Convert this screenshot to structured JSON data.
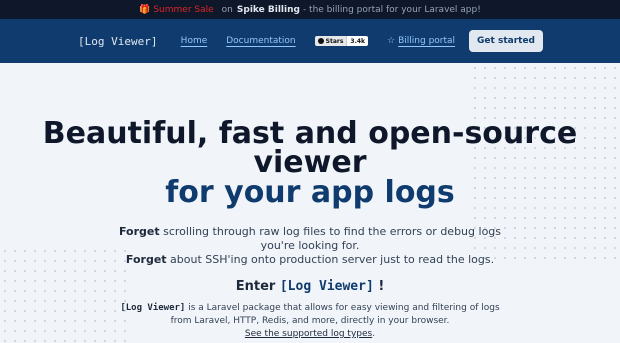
{
  "announcement": {
    "icon": "gift-icon",
    "sale": "Summer Sale",
    "on": "on",
    "product": "Spike Billing",
    "rest": "- the billing portal for your Laravel app!"
  },
  "header": {
    "logo": "[Log Viewer]",
    "nav": {
      "home": "Home",
      "documentation": "Documentation",
      "billing": "Billing portal"
    },
    "github": {
      "label": "Stars",
      "count": "3.4k"
    },
    "cta": "Get started"
  },
  "hero": {
    "line1": "Beautiful, fast and open-source",
    "line2": "viewer",
    "line3": "for your app logs",
    "lead1_bold": "Forget",
    "lead1": "scrolling through raw log files to find the errors or debug logs you're looking for.",
    "lead2_bold": "Forget",
    "lead2": "about SSH'ing onto production server just to read the logs.",
    "enter": "Enter",
    "enter_mono": "[Log Viewer]",
    "enter_end": "!",
    "desc_mono": "[Log Viewer]",
    "desc": "is a Laravel package that allows for easy viewing and filtering of logs from Laravel, HTTP, Redis, and more, directly in your browser.",
    "see_link": "See the supported log types",
    "see_end": "."
  },
  "colors": {
    "brand": "#0f3b6e",
    "accent_red": "#dc2626",
    "background": "#f1f5f9"
  }
}
